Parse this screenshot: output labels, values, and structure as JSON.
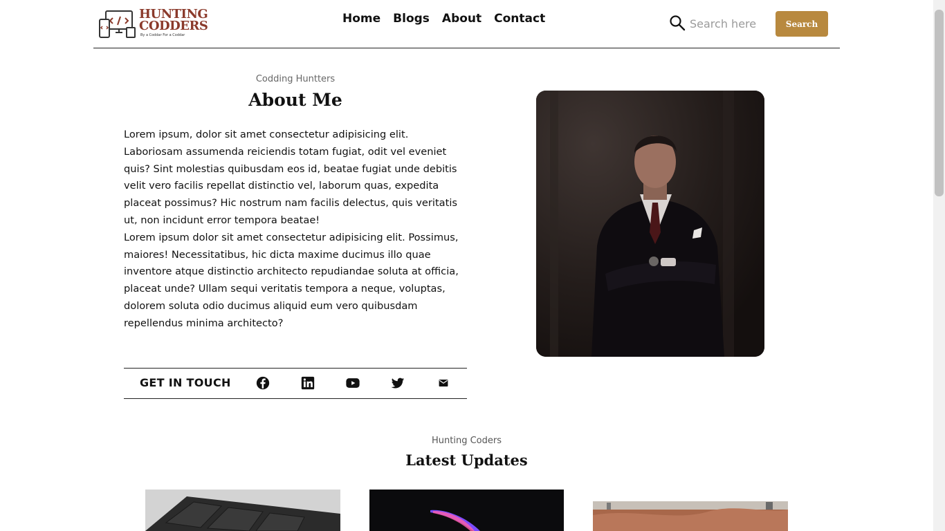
{
  "logo": {
    "title": "HUNTING\nCODDERS",
    "tagline": "By a Coddar For a Coddar"
  },
  "nav": {
    "items": [
      {
        "label": "Home"
      },
      {
        "label": "Blogs"
      },
      {
        "label": "About"
      },
      {
        "label": "Contact"
      }
    ]
  },
  "search": {
    "placeholder": "Search here",
    "value": "",
    "button_label": "Search"
  },
  "about": {
    "eyebrow": "Codding Huntters",
    "title": "About Me",
    "paragraphs": [
      "Lorem ipsum, dolor sit amet consectetur adipisicing elit. Laboriosam assumenda reiciendis totam fugiat, odit vel eveniet quis? Sint molestias quibusdam eos id, beatae fugiat unde debitis velit vero facilis repellat distinctio vel, laborum quas, expedita placeat possimus? Hic nostrum nam facilis delectus, quis veritatis ut, non incidunt error tempora beatae!",
      "Lorem ipsum dolor sit amet consectetur adipisicing elit. Possimus, maiores! Necessitatibus, hic dicta maxime ducimus illo quae inventore atque distinctio architecto repudiandae soluta at officia, placeat unde? Ullam sequi veritatis tempora a neque, voluptas, dolorem soluta odio ducimus aliquid eum vero quibusdam repellendus minima architecto?"
    ],
    "contact_label": "GET IN TOUCH",
    "social_icons": [
      "facebook-icon",
      "linkedin-icon",
      "youtube-icon",
      "twitter-icon",
      "mail-icon"
    ]
  },
  "updates": {
    "eyebrow": "Hunting Coders",
    "title": "Latest Updates"
  },
  "colors": {
    "brand": "#8b3a2b",
    "accent": "#b8893f",
    "text": "#111111"
  }
}
